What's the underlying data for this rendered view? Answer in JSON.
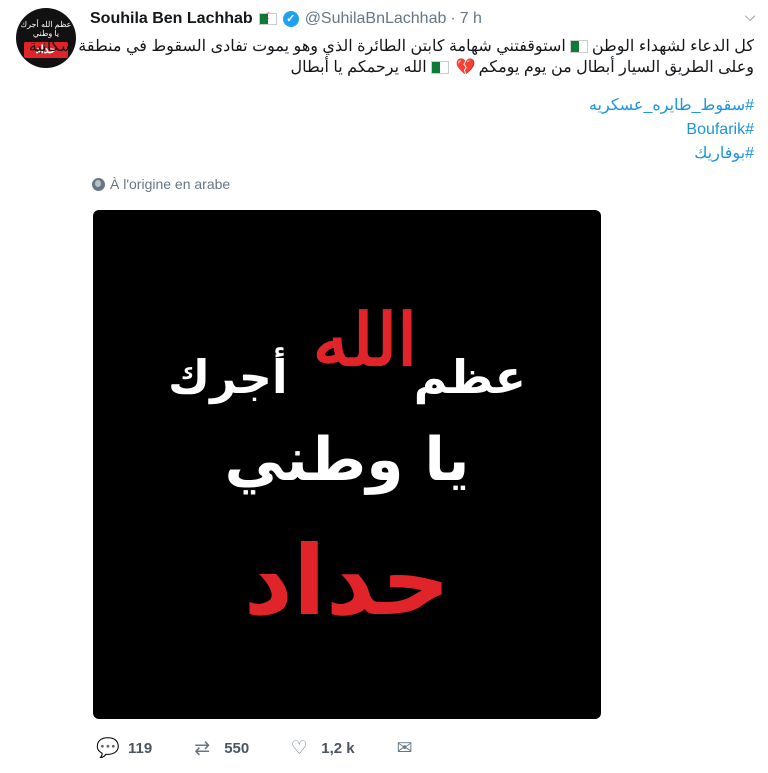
{
  "author": {
    "name": "Souhila Ben Lachhab",
    "handle": "@SuhilaBnLachhab",
    "separator": "·",
    "time": "7 h"
  },
  "avatar": {
    "top_text": "عظم الله أجرك",
    "mid_text": "يا وطني",
    "bar_text": "حداد"
  },
  "tweet": {
    "line1_a": "كل الدعاء لشهداء الوطن",
    "line1_b": "استوقفتني شهامة  كابتن الطائرة الذي وهو يموت تفادى السقوط في منطقة سكانية",
    "line2_a": "وعلى الطريق السيار أبطال من يوم يومكم",
    "line2_b": "الله يرحمكم يا أبطال",
    "broken_heart": "💔",
    "hashtags": [
      "#سقوط_طايره_عسكريه",
      "#Boufarik",
      "#بوفاريك"
    ]
  },
  "translate": {
    "label": "À l'origine en arabe",
    "icon": "globe-icon"
  },
  "media": {
    "word_left": "عظم",
    "word_allah": "الله",
    "word_right": "أجرك",
    "line2": "يا وطني",
    "line3": "حداد",
    "bg_color": "#000000",
    "red_color": "#e0242a"
  },
  "actions": {
    "reply_icon": "reply-icon",
    "reply_count": "119",
    "retweet_icon": "retweet-icon",
    "retweet_count": "550",
    "like_icon": "heart-icon",
    "like_count": "1,2 k",
    "dm_icon": "envelope-icon"
  },
  "colors": {
    "link": "#1b95e0",
    "muted": "#657786",
    "verified": "#1da1f2"
  }
}
